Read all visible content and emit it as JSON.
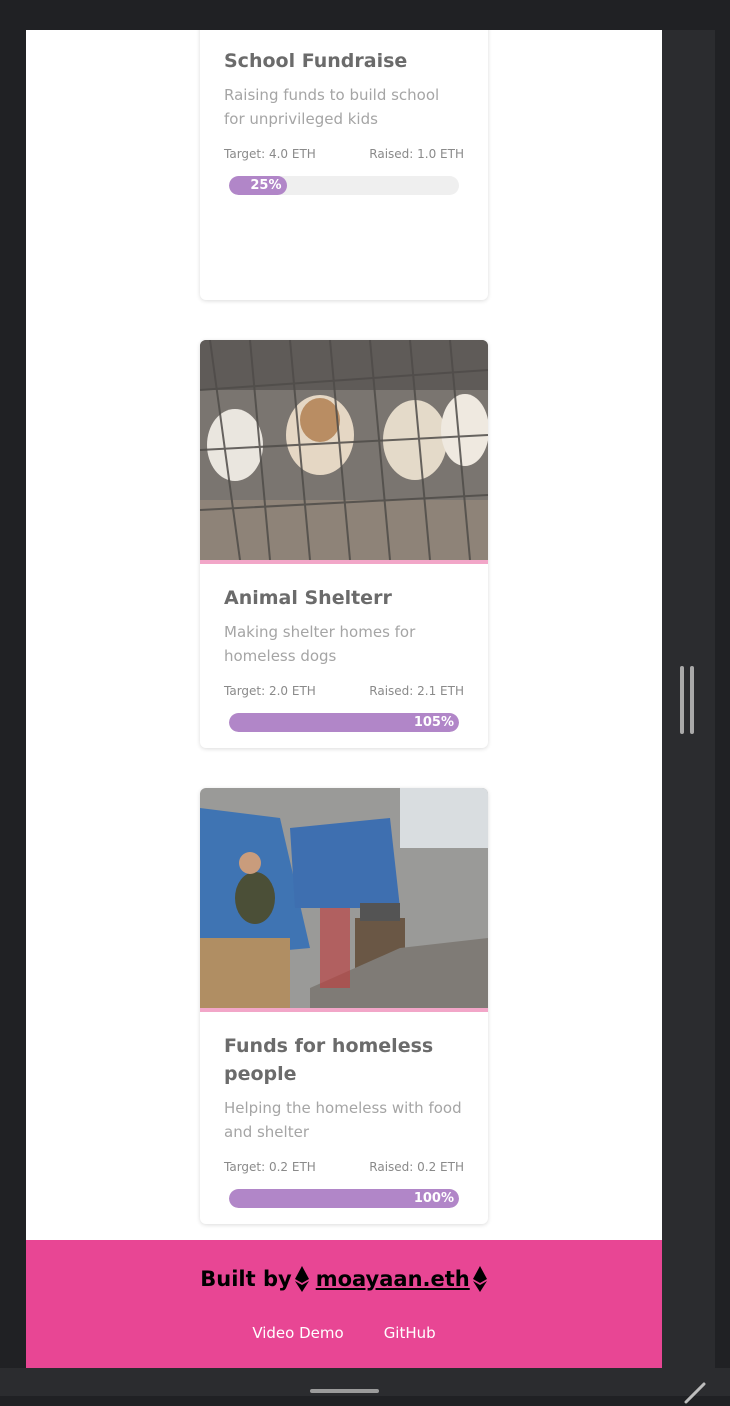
{
  "campaigns": [
    {
      "title": "School Fundraise",
      "description": "Raising funds to build school for unprivileged kids",
      "target": "Target: 4.0 ETH",
      "raised": "Raised: 1.0 ETH",
      "progress_label": "25%",
      "progress": 0.25
    },
    {
      "title": "Animal Shelterr",
      "description": "Making shelter homes for homeless dogs",
      "target": "Target: 2.0 ETH",
      "raised": "Raised: 2.1 ETH",
      "progress_label": "105%",
      "progress": 1.05
    },
    {
      "title": "Funds for homeless people",
      "description": "Helping the homeless with food and shelter",
      "target": "Target: 0.2 ETH",
      "raised": "Raised: 0.2 ETH",
      "progress_label": "100%",
      "progress": 1.0
    }
  ],
  "footer": {
    "built_by": "Built by",
    "author": "moayaan.eth",
    "links": {
      "video": "Video Demo",
      "github": "GitHub"
    }
  },
  "colors": {
    "footer_bg": "#e84694",
    "progress_fill": "#b186c8",
    "image_stripe": "#f2a6c8"
  },
  "icons": {
    "eth": "ethereum-icon"
  }
}
